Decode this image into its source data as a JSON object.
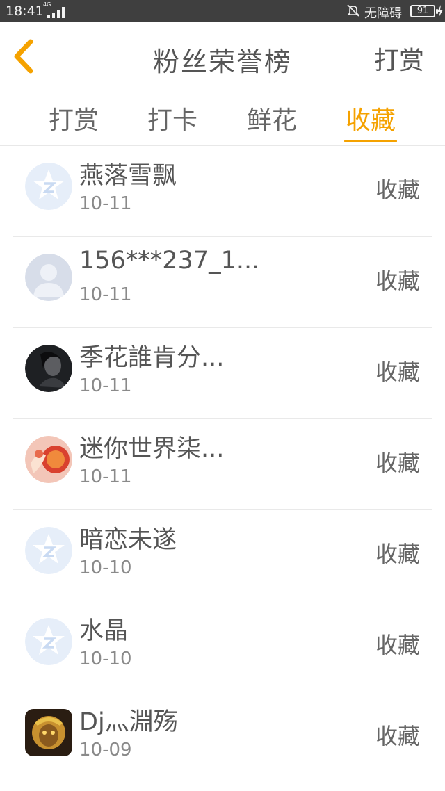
{
  "status_bar": {
    "time": "18:41",
    "network_tag": "4G",
    "silent_label": "无障碍",
    "battery": "91"
  },
  "header": {
    "title": "粉丝荣誉榜",
    "action_label": "打赏",
    "back_icon": "chevron-left-icon"
  },
  "colors": {
    "accent": "#f5a200",
    "status_bar_bg": "#3f3f3f",
    "text": "#555555",
    "divider": "#e9e9e9"
  },
  "tabs": [
    {
      "label": "打赏",
      "active": false
    },
    {
      "label": "打卡",
      "active": false
    },
    {
      "label": "鲜花",
      "active": false
    },
    {
      "label": "收藏",
      "active": true
    }
  ],
  "list": [
    {
      "name": "燕落雪飘",
      "date": "10-11",
      "action": "收藏",
      "avatar": "default-qzone-avatar-icon"
    },
    {
      "name": "156***237_1...",
      "date": "10-11",
      "action": "收藏",
      "avatar": "default-person-avatar-icon"
    },
    {
      "name": "季花誰肯分...",
      "date": "10-11",
      "action": "收藏",
      "avatar": "dark-portrait-avatar"
    },
    {
      "name": "迷你世界柒...",
      "date": "10-11",
      "action": "收藏",
      "avatar": "red-game-avatar"
    },
    {
      "name": "暗恋未遂",
      "date": "10-10",
      "action": "收藏",
      "avatar": "default-qzone-avatar-icon"
    },
    {
      "name": "水晶",
      "date": "10-10",
      "action": "收藏",
      "avatar": "default-qzone-avatar-icon"
    },
    {
      "name": "Dj灬淵殇",
      "date": "10-09",
      "action": "收藏",
      "avatar": "monkey-king-avatar"
    }
  ]
}
